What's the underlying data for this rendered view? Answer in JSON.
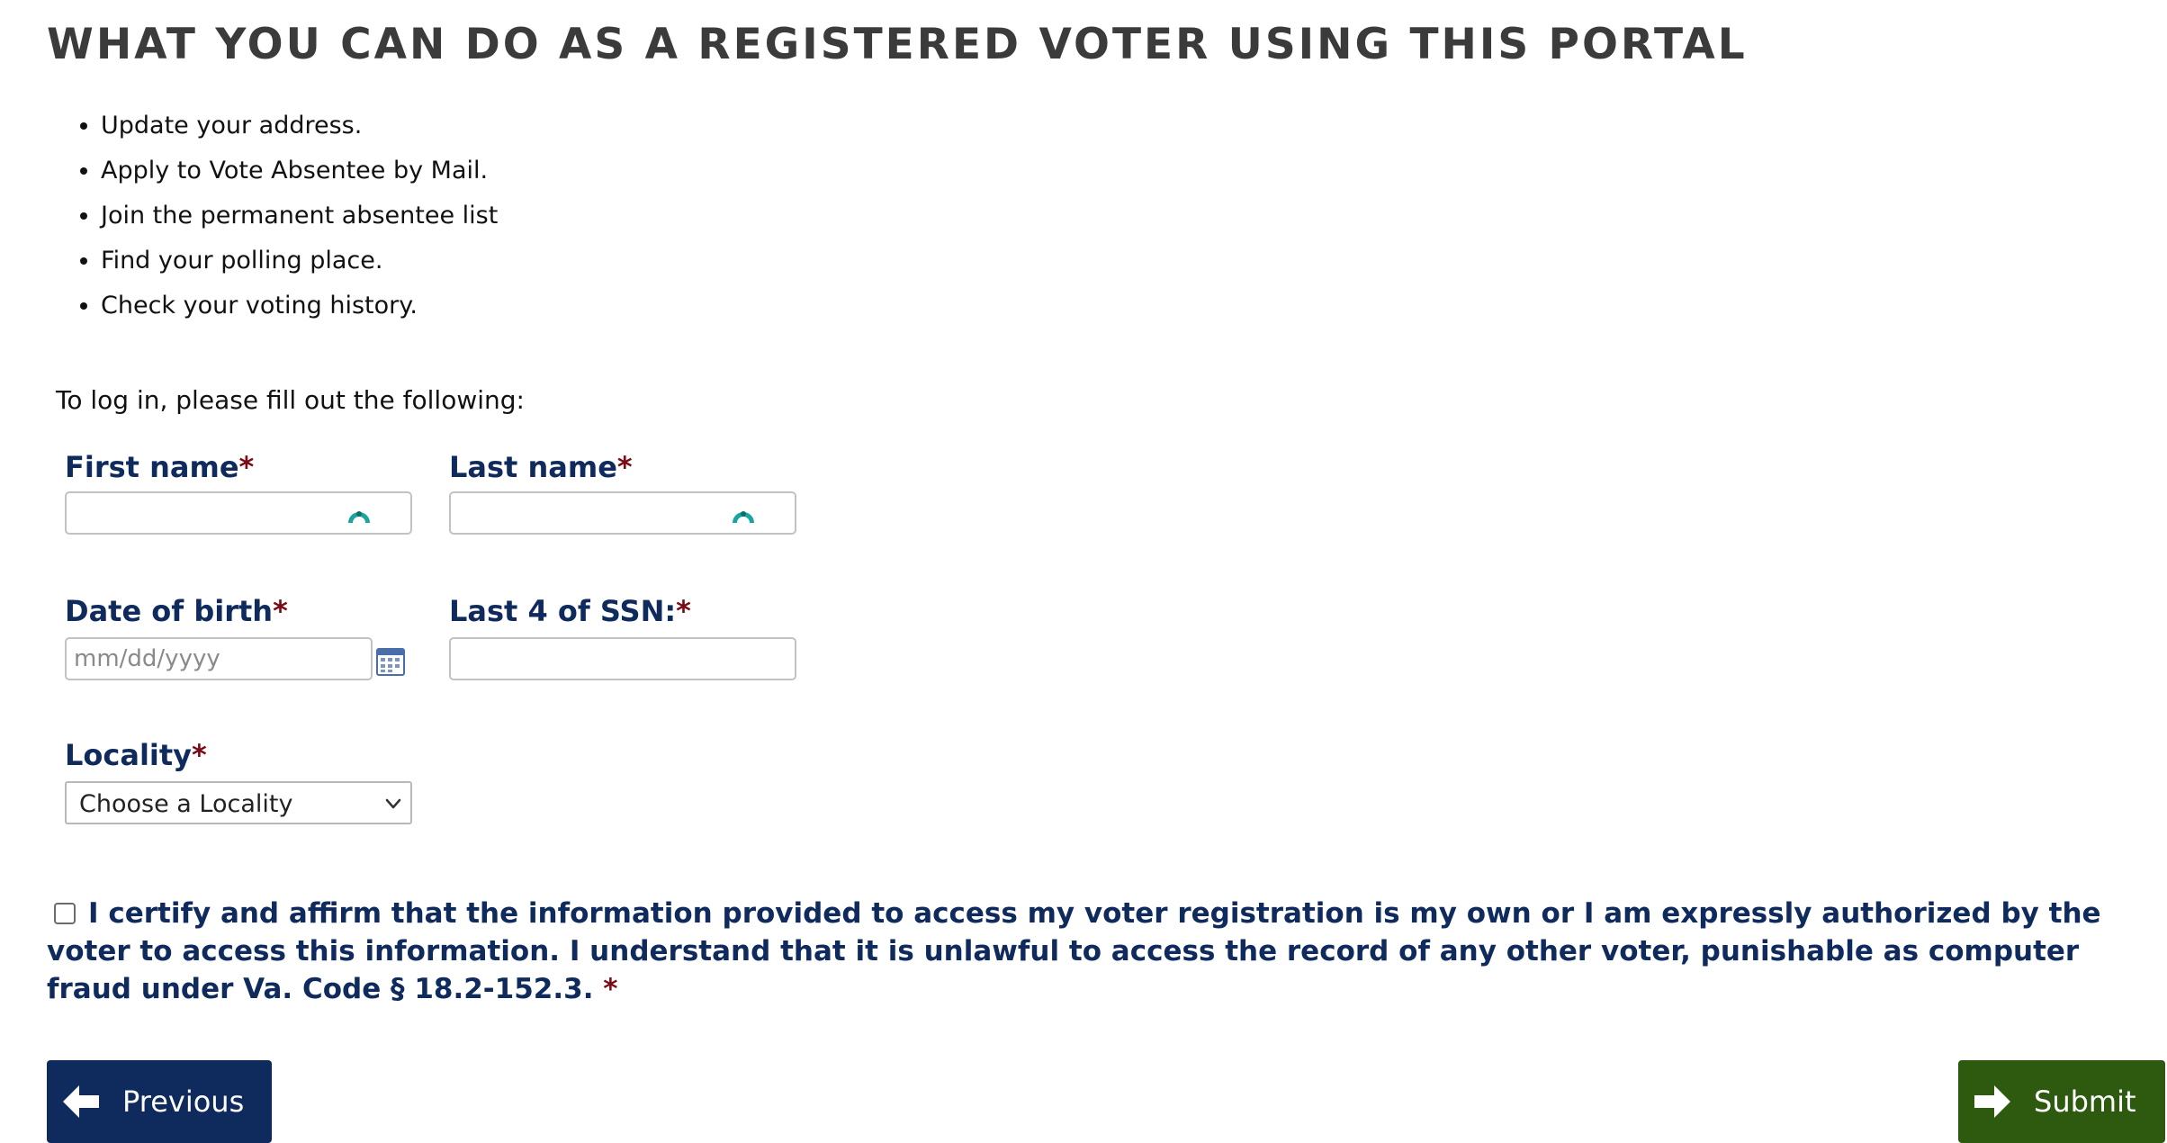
{
  "page": {
    "heading": "WHAT YOU CAN DO AS A REGISTERED VOTER USING THIS PORTAL",
    "features": [
      "Update your address.",
      "Apply to Vote Absentee by Mail.",
      "Join the permanent absentee list",
      "Find your polling place.",
      "Check your voting history."
    ],
    "intro": "To log in, please fill out the following:"
  },
  "form": {
    "required_marker": "*",
    "first_name": {
      "label": "First name",
      "value": ""
    },
    "last_name": {
      "label": "Last name",
      "value": ""
    },
    "dob": {
      "label": "Date of birth",
      "placeholder": "mm/dd/yyyy",
      "value": ""
    },
    "ssn": {
      "label": "Last 4 of SSN:",
      "value": ""
    },
    "locality": {
      "label": "Locality",
      "selected": "Choose a Locality"
    },
    "certify": {
      "checked": false,
      "text": "I certify and affirm that the information provided to access my voter registration is my own or I am expressly authorized by the voter to access this information. I understand that it is unlawful to access the record of any other voter, punishable as computer fraud under Va. Code § 18.2-152.3."
    }
  },
  "buttons": {
    "previous": "Previous",
    "submit": "Submit"
  },
  "colors": {
    "label_navy": "#0f2a5c",
    "required_red": "#7a0a16",
    "previous_button": "#0f2a5c",
    "submit_button": "#2d5a0e",
    "autofill_icon": "#1aa5a0"
  },
  "icons": {
    "previous": "arrow-left-icon",
    "submit": "arrow-right-icon",
    "autofill": "password-manager-icon",
    "calendar": "calendar-icon",
    "dropdown": "chevron-down-icon"
  }
}
